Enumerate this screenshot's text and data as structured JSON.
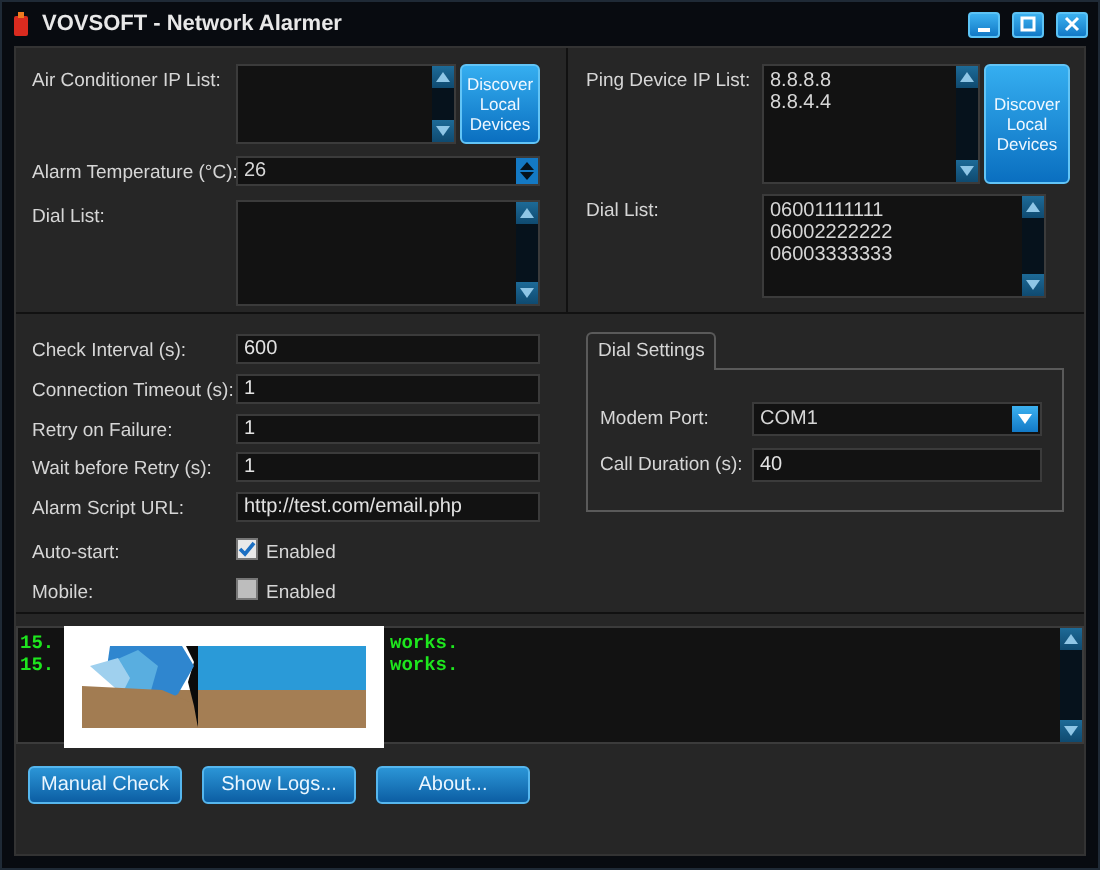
{
  "window": {
    "title": "VOVSOFT - Network Alarmer"
  },
  "air_conditioner": {
    "label": "Air Conditioner IP List:",
    "button": "Discover Local Devices"
  },
  "alarm_temperature": {
    "label": "Alarm Temperature (°C):",
    "value": "26"
  },
  "dial_list_left": {
    "label": "Dial List:"
  },
  "ping": {
    "label": "Ping Device IP List:",
    "items": [
      "8.8.8.8",
      "8.8.4.4"
    ],
    "button": "Discover Local Devices"
  },
  "dial_list_right": {
    "label": "Dial List:",
    "items": [
      "06001111111",
      "06002222222",
      "06003333333"
    ]
  },
  "settings": [
    {
      "label": "Check Interval (s):",
      "kind": "text",
      "value": "600"
    },
    {
      "label": "Connection Timeout (s):",
      "kind": "text",
      "value": "1"
    },
    {
      "label": "Retry on Failure:",
      "kind": "text",
      "value": "1"
    },
    {
      "label": "Wait before Retry (s):",
      "kind": "text",
      "value": "1"
    },
    {
      "label": "Alarm Script URL:",
      "kind": "text",
      "value": "http://test.com/email.php"
    },
    {
      "label": "Auto-start:",
      "kind": "checkbox",
      "checked": true,
      "text": "Enabled"
    },
    {
      "label": "Mobile:",
      "kind": "checkbox",
      "checked": false,
      "text": "Enabled"
    }
  ],
  "dial_settings": {
    "tab": "Dial Settings",
    "fields": [
      {
        "label": "Modem Port:",
        "kind": "select",
        "value": "COM1"
      },
      {
        "label": "Call Duration (s):",
        "kind": "text",
        "value": "40"
      }
    ]
  },
  "log": {
    "lines": [
      {
        "start": "15.",
        "end": "works."
      },
      {
        "start": "15.",
        "end": "works."
      }
    ]
  },
  "buttons": [
    "Manual Check",
    "Show Logs...",
    "About..."
  ]
}
